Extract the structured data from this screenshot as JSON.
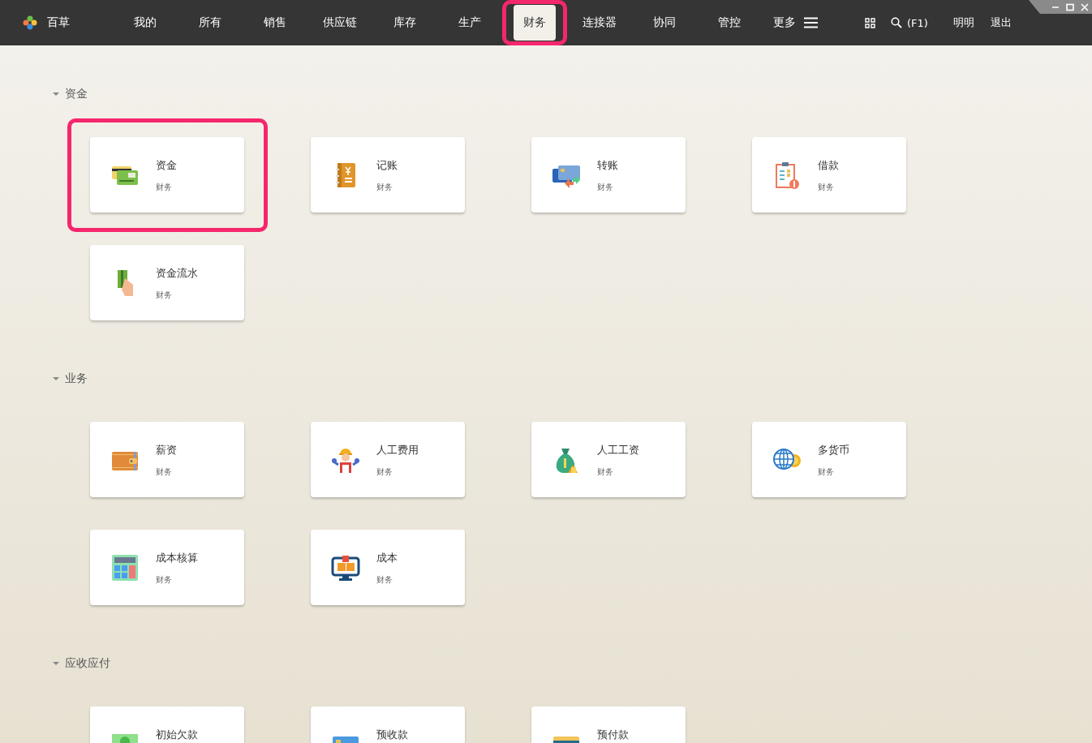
{
  "app": {
    "name": "百草"
  },
  "nav": [
    {
      "label": "我的",
      "selected": false,
      "highlighted": false
    },
    {
      "label": "所有",
      "selected": false,
      "highlighted": false
    },
    {
      "label": "销售",
      "selected": false,
      "highlighted": false
    },
    {
      "label": "供应链",
      "selected": false,
      "highlighted": false
    },
    {
      "label": "库存",
      "selected": false,
      "highlighted": false
    },
    {
      "label": "生产",
      "selected": false,
      "highlighted": false
    },
    {
      "label": "财务",
      "selected": true,
      "highlighted": true
    },
    {
      "label": "连接器",
      "selected": false,
      "highlighted": false
    },
    {
      "label": "协同",
      "selected": false,
      "highlighted": false
    },
    {
      "label": "管控",
      "selected": false,
      "highlighted": false
    }
  ],
  "nav_more": {
    "label": "更多"
  },
  "search": {
    "shortcut": "(F1)"
  },
  "user": {
    "name": "明明"
  },
  "logout": {
    "label": "退出"
  },
  "sections": [
    {
      "title": "资金",
      "expanded": true,
      "items": [
        {
          "title": "资金",
          "subtitle": "财务",
          "highlighted": true
        },
        {
          "title": "记账",
          "subtitle": "财务",
          "highlighted": false
        },
        {
          "title": "转账",
          "subtitle": "财务",
          "highlighted": false
        },
        {
          "title": "借款",
          "subtitle": "财务",
          "highlighted": false
        },
        {
          "title": "资金流水",
          "subtitle": "财务",
          "highlighted": false
        }
      ]
    },
    {
      "title": "业务",
      "expanded": true,
      "items": [
        {
          "title": "薪资",
          "subtitle": "财务",
          "highlighted": false
        },
        {
          "title": "人工费用",
          "subtitle": "财务",
          "highlighted": false
        },
        {
          "title": "人工工资",
          "subtitle": "财务",
          "highlighted": false
        },
        {
          "title": "多货币",
          "subtitle": "财务",
          "highlighted": false
        },
        {
          "title": "成本核算",
          "subtitle": "财务",
          "highlighted": false
        },
        {
          "title": "成本",
          "subtitle": "财务",
          "highlighted": false
        }
      ]
    },
    {
      "title": "应收应付",
      "expanded": true,
      "items": [
        {
          "title": "初始欠款",
          "highlighted": false
        },
        {
          "title": "预收款",
          "highlighted": false
        },
        {
          "title": "预付款",
          "highlighted": false
        }
      ]
    }
  ]
}
